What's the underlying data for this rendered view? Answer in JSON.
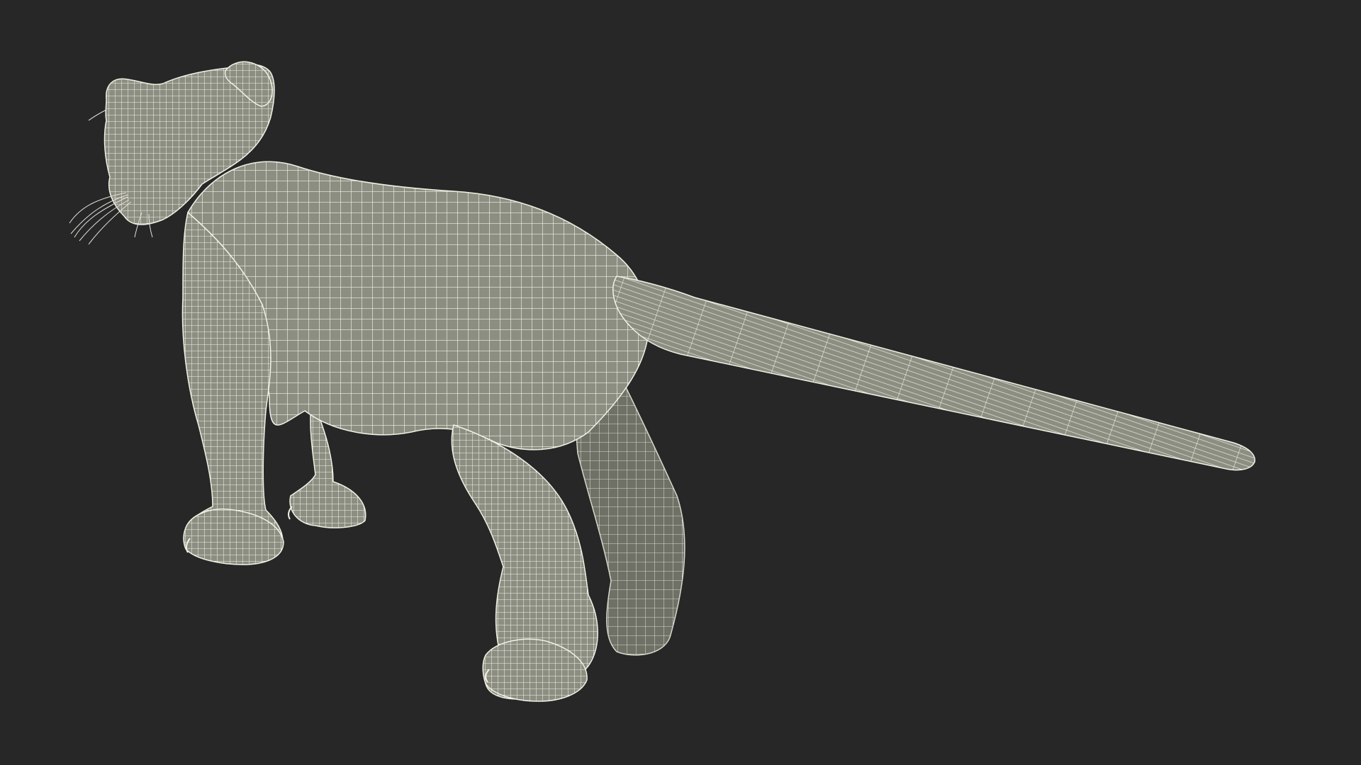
{
  "scene": {
    "background_color": "#272727",
    "model_fill_color": "#8c8e82",
    "model_shadow_color": "#6f7166",
    "wire_color": "#f2f1e6"
  }
}
